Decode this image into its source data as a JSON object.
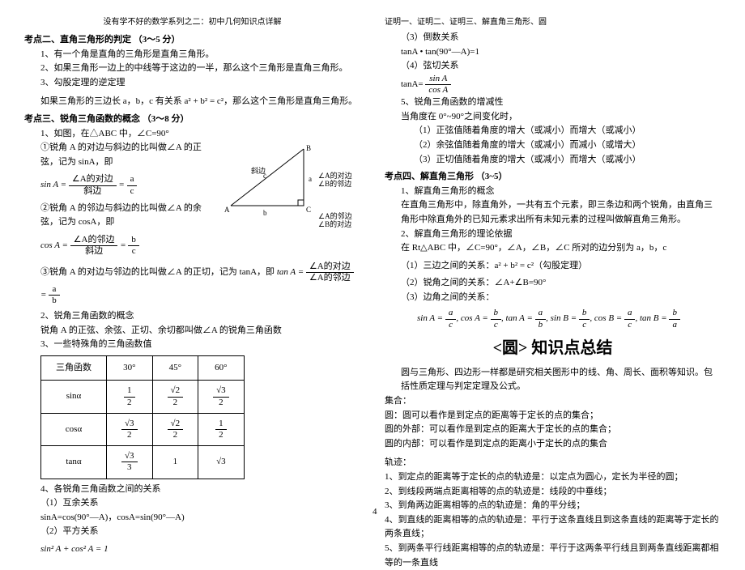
{
  "top_header": "没有学不好的数学系列之二：初中几何知识点详解",
  "pagenum": "4",
  "left": {
    "kd2_title": "考点二、直角三角形的判定   （3～5 分）",
    "kd2_1": "1、有一个角是直角的三角形是直角三角形。",
    "kd2_2": "2、如果三角形一边上的中线等于这边的一半，那么这个三角形是直角三角形。",
    "kd2_3": "3、勾股定理的逆定理",
    "kd2_pyth": "如果三角形的三边长 a，b，c 有关系 a² + b² = c²，那么这个三角形是直角三角形。",
    "kd3_title": "考点三、锐角三角函数的概念   （3～8 分）",
    "kd3_1": "1、如图，在△ABC 中，∠C=90°",
    "kd3_sin_text": "①锐角 A 的对边与斜边的比叫做∠A 的正弦，记为 sinA，即",
    "kd3_sin_eq_lhs": "sin A =",
    "kd3_sin_num": "∠A的对边",
    "kd3_sin_den": "斜边",
    "kd3_sin_fr2n": "a",
    "kd3_sin_fr2d": "c",
    "kd3_cos_text": "②锐角 A 的邻边与斜边的比叫做∠A 的余弦，记为 cosA，即",
    "kd3_cos_eq_lhs": "cos A =",
    "kd3_cos_num": "∠A的邻边",
    "kd3_cos_den": "斜边",
    "kd3_cos_fr2n": "b",
    "kd3_cos_fr2d": "c",
    "kd3_tan_text": "③锐角 A 的对边与邻边的比叫做∠A 的正切，记为 tanA，即",
    "kd3_tan_lhs": "tan A =",
    "kd3_tan_num": "∠A的对边",
    "kd3_tan_den": "∠A的邻边",
    "kd3_tan_fr2n": "a",
    "kd3_tan_fr2d": "b",
    "kd3_2": "2、锐角三角函数的概念",
    "kd3_2_text": "锐角 A 的正弦、余弦、正切、余切都叫做∠A 的锐角三角函数",
    "kd3_3": "3、一些特殊角的三角函数值",
    "table": {
      "r0c0": "三角函数",
      "r0c1": "30°",
      "r0c2": "45°",
      "r0c3": "60°",
      "r1c0": "sinα",
      "r1c1_n": "1",
      "r1c1_d": "2",
      "r1c2_n": "√2",
      "r1c2_d": "2",
      "r1c3_n": "√3",
      "r1c3_d": "2",
      "r2c0": "cosα",
      "r2c1_n": "√3",
      "r2c1_d": "2",
      "r2c2_n": "√2",
      "r2c2_d": "2",
      "r2c3_n": "1",
      "r2c3_d": "2",
      "r3c0": "tanα",
      "r3c1_n": "√3",
      "r3c1_d": "3",
      "r3c2": "1",
      "r3c3": "√3"
    },
    "kd3_4": "4、各锐角三角函数之间的关系",
    "kd3_4_1": "（1）互余关系",
    "kd3_4_1_eq": "sinA=cos(90°—A)，cosA=sin(90°—A)",
    "kd3_4_2": "（2）平方关系",
    "kd3_4_2_eq": "sin² A + cos² A = 1",
    "diagram": {
      "B": "B",
      "A": "A",
      "C": "C",
      "hyp": "斜边",
      "a": "a",
      "b": "b",
      "c": "c",
      "angleA_opp": "∠A的对边",
      "angleB_adj": "∠B的邻边",
      "angleA_adj": "∠A的邻边",
      "angleB_opp": "∠B的对边"
    }
  },
  "right": {
    "proof_line": "证明一、证明二、证明三、解直角三角形、圆",
    "r3": "（3）倒数关系",
    "r3_eq": "tanA • tan(90°—A)=1",
    "r4": "（4）弦切关系",
    "r4_lhs": "tanA=",
    "r4_num": "sin A",
    "r4_den": "cos A",
    "r5": "5、锐角三角函数的增减性",
    "r5_text": "当角度在 0°~90°之间变化时，",
    "r5_1": "（1）正弦值随着角度的增大（或减小）而增大（或减小）",
    "r5_2": "（2）余弦值随着角度的增大（或减小）而减小（或增大）",
    "r5_3": "（3）正切值随着角度的增大（或减小）而增大（或减小）",
    "kd4_title": "考点四、解直角三角形    （3~5）",
    "kd4_1": "1、解直角三角形的概念",
    "kd4_1_text": "在直角三角形中，除直角外，一共有五个元素，即三条边和两个锐角，由直角三角形中除直角外的已知元素求出所有未知元素的过程叫做解直角三角形。",
    "kd4_2": "2、解直角三角形的理论依据",
    "kd4_2_text": "在 Rt△ABC 中，∠C=90°，∠A，∠B，∠C 所对的边分别为 a，b，c",
    "kd4_2_1": "（1）三边之间的关系：a² + b² = c²（勾股定理）",
    "kd4_2_2": "（2）锐角之间的关系：∠A+∠B=90°",
    "kd4_2_3": "（3）边角之间的关系：",
    "edge_eq_prefix": "sin A = ",
    "edge": {
      "sinA_n": "a",
      "sinA_d": "c",
      "cosA_n": "b",
      "cosA_d": "c",
      "tanA_n": "a",
      "tanA_d": "b",
      "sinB_n": "b",
      "sinB_d": "c",
      "cosB_n": "a",
      "cosB_d": "c",
      "tanB_n": "b",
      "tanB_d": "a"
    },
    "circle_title": "<圆> 知识点总结",
    "circle_intro": "圆与三角形、四边形一样都是研究相关图形中的线、角、周长、面积等知识。包括性质定理与判定定理及公式。",
    "set_h": "集合：",
    "set_1": "圆：圆可以看作是到定点的距离等于定长的点的集合；",
    "set_2": "圆的外部：可以看作是到定点的距离大于定长的点的集合；",
    "set_3": "圆的内部：可以看作是到定点的距离小于定长的点的集合",
    "locus_h": "轨迹：",
    "locus_1": "1、到定点的距离等于定长的点的轨迹是：以定点为圆心，定长为半径的圆；",
    "locus_2": "2、到线段两端点距离相等的点的轨迹是：线段的中垂线；",
    "locus_3": "3、到角两边距离相等的点的轨迹是：角的平分线；",
    "locus_4": "4、到直线的距离相等的点的轨迹是：平行于这条直线且到这条直线的距离等于定长的两条直线；",
    "locus_5": "5、到两条平行线距离相等的点的轨迹是：平行于这两条平行线且到两条直线距离都相等的一条直线"
  }
}
